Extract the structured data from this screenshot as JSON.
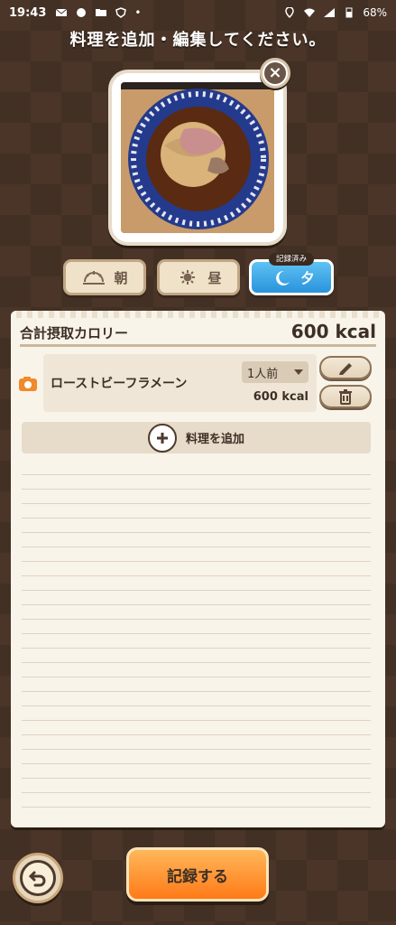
{
  "status_bar": {
    "time": "19:43",
    "dot": "•",
    "battery": "68%"
  },
  "header": {
    "title": "料理を追加・編集してください。"
  },
  "meal_tabs": {
    "breakfast": "朝",
    "lunch": "昼",
    "dinner": "夕",
    "recorded_badge": "記録済み"
  },
  "summary": {
    "total_label": "合計摂取カロリー",
    "total_value": "600 kcal"
  },
  "food_item": {
    "name": "ローストビーフラメーン",
    "portion": "1人前",
    "kcal": "600 kcal"
  },
  "actions": {
    "add_dish": "料理を追加",
    "record": "記録する"
  },
  "colors": {
    "accent_blue": "#2a93dc",
    "accent_orange": "#ff7a18",
    "text_brown": "#3d2f25"
  }
}
